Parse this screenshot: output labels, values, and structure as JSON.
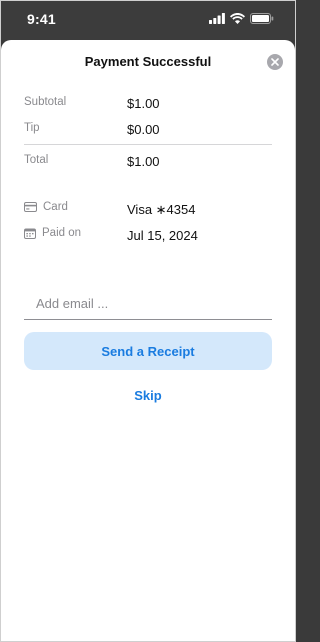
{
  "status_bar": {
    "time": "9:41"
  },
  "sheet": {
    "title": "Payment Successful",
    "summary": {
      "subtotal_label": "Subtotal",
      "subtotal_value": "$1.00",
      "tip_label": "Tip",
      "tip_value": "$0.00",
      "total_label": "Total",
      "total_value": "$1.00"
    },
    "details": {
      "card_label": "Card",
      "card_value": "Visa ∗4354",
      "paid_on_label": "Paid on",
      "paid_on_value": "Jul 15, 2024"
    },
    "email": {
      "placeholder": "Add email ...",
      "value": ""
    },
    "send_receipt_label": "Send a Receipt",
    "skip_label": "Skip"
  },
  "colors": {
    "accent": "#1a7ce0",
    "button_bg": "#d4e8fb",
    "label_gray": "#8a8a8e"
  },
  "icons": [
    "cellular-signal-icon",
    "wifi-icon",
    "battery-icon",
    "close-icon",
    "credit-card-icon",
    "calendar-icon"
  ]
}
